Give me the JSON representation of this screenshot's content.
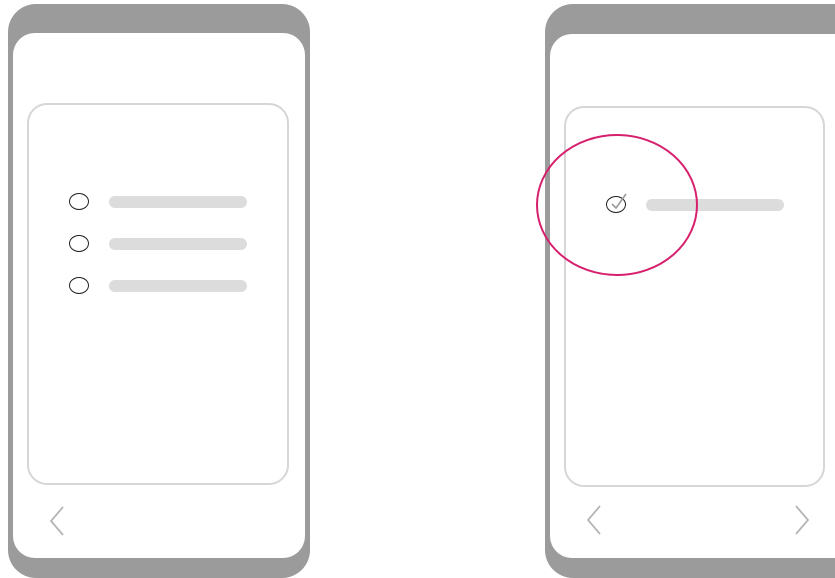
{
  "colors": {
    "phone_frame": "#9b9b9b",
    "screen": "#ffffff",
    "card_border": "#d6d6d6",
    "placeholder_line": "#dcdcdc",
    "radio_stroke": "#222222",
    "nav_arrow": "#b5b5b5",
    "highlight_circle": "#d6206e"
  },
  "left_phone": {
    "options": [
      {
        "icon": "radio-empty-icon",
        "selected": false
      },
      {
        "icon": "radio-empty-icon",
        "selected": false
      },
      {
        "icon": "radio-empty-icon",
        "selected": false
      }
    ],
    "nav": {
      "back_icon": "chevron-left-icon",
      "forward_icon": null
    }
  },
  "right_phone": {
    "options": [
      {
        "icon": "radio-checked-icon",
        "selected": true
      }
    ],
    "highlight": {
      "icon": "highlight-circle",
      "target": "selected-option"
    },
    "nav": {
      "back_icon": "chevron-left-icon",
      "forward_icon": "chevron-right-icon"
    }
  }
}
